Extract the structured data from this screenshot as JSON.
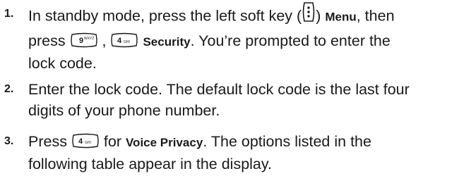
{
  "steps": [
    {
      "number": "1.",
      "lines": [
        {
          "a": "In standby mode, press the left soft key (",
          "b": ") ",
          "menu": "Menu",
          "c": ", then"
        },
        {
          "a": "press ",
          "b": " , ",
          "security": "Security",
          "c": ". You’re prompted to enter the"
        },
        {
          "a": "lock code."
        }
      ]
    },
    {
      "number": "2.",
      "lines": [
        {
          "a": "Enter the lock code. The default lock code is the last four"
        },
        {
          "a": "digits of your phone number."
        }
      ]
    },
    {
      "number": "3.",
      "lines": [
        {
          "a": "Press ",
          "b": " for ",
          "voice_privacy": "Voice Privacy",
          "c": ". The options listed in the"
        },
        {
          "a": "following table appear in the display."
        }
      ]
    }
  ],
  "keys": {
    "nine": {
      "digit": "9",
      "letters": "WXYZ"
    },
    "four": {
      "digit": "4",
      "letters": "GHI"
    }
  },
  "icons": {
    "left_soft_key": "left-soft-key-icon",
    "key_9": "key-9-wxyz-icon",
    "key_4": "key-4-ghi-icon"
  }
}
